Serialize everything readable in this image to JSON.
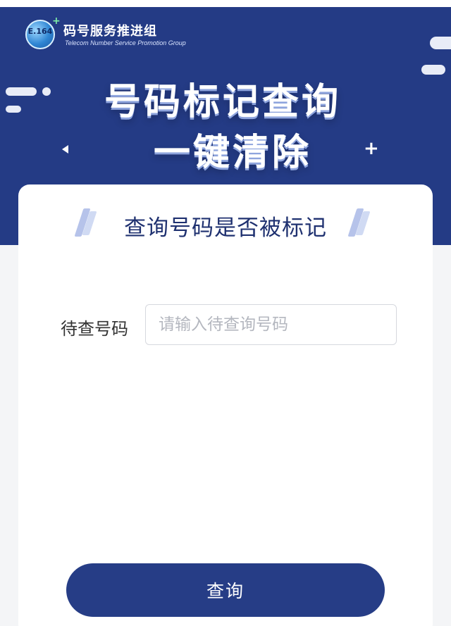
{
  "brand": {
    "logo_text": "E.164",
    "name": "码号服务推进组",
    "subtitle": "Telecom Number Service  Promotion Group"
  },
  "hero": {
    "line1": "号码标记查询",
    "line2": "一键清除"
  },
  "card": {
    "title": "查询号码是否被标记"
  },
  "form": {
    "number_label": "待查号码",
    "number_placeholder": "请输入待查询号码",
    "number_value": ""
  },
  "actions": {
    "query_label": "查询"
  },
  "colors": {
    "primary": "#243b85",
    "button": "#263d86",
    "title_text": "#1f3170",
    "page_bg": "#f4f5f7"
  }
}
